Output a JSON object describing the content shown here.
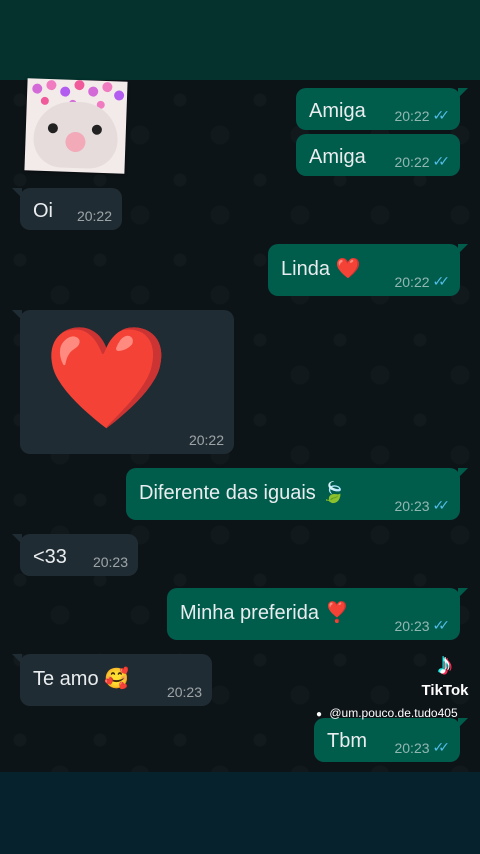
{
  "chat": {
    "messages": [
      {
        "text": "Amiga",
        "time": "20:22",
        "ticks": "✓✓"
      },
      {
        "text": "Amiga",
        "time": "20:22",
        "ticks": "✓✓"
      },
      {
        "text": "Oi",
        "time": "20:22"
      },
      {
        "text": "Linda",
        "emoji": "❤️",
        "time": "20:22",
        "ticks": "✓✓"
      },
      {
        "emoji": "❤️",
        "time": "20:22"
      },
      {
        "text": "Diferente das iguais",
        "emoji": "🍃",
        "time": "20:23",
        "ticks": "✓✓"
      },
      {
        "text": "<33",
        "time": "20:23"
      },
      {
        "text": "Minha preferida",
        "emoji": "❣️",
        "time": "20:23",
        "ticks": "✓✓"
      },
      {
        "text": "Te amo",
        "emoji": "🥰",
        "time": "20:23"
      },
      {
        "text": "Tbm",
        "time": "20:23",
        "ticks": "✓✓"
      }
    ]
  },
  "watermark": {
    "logo_text": "TikTok",
    "handle": "@um.pouco.de.tudo405"
  },
  "colors": {
    "outgoing_bubble": "#005c4b",
    "incoming_bubble": "#202c33",
    "read_ticks": "#53bdeb"
  }
}
